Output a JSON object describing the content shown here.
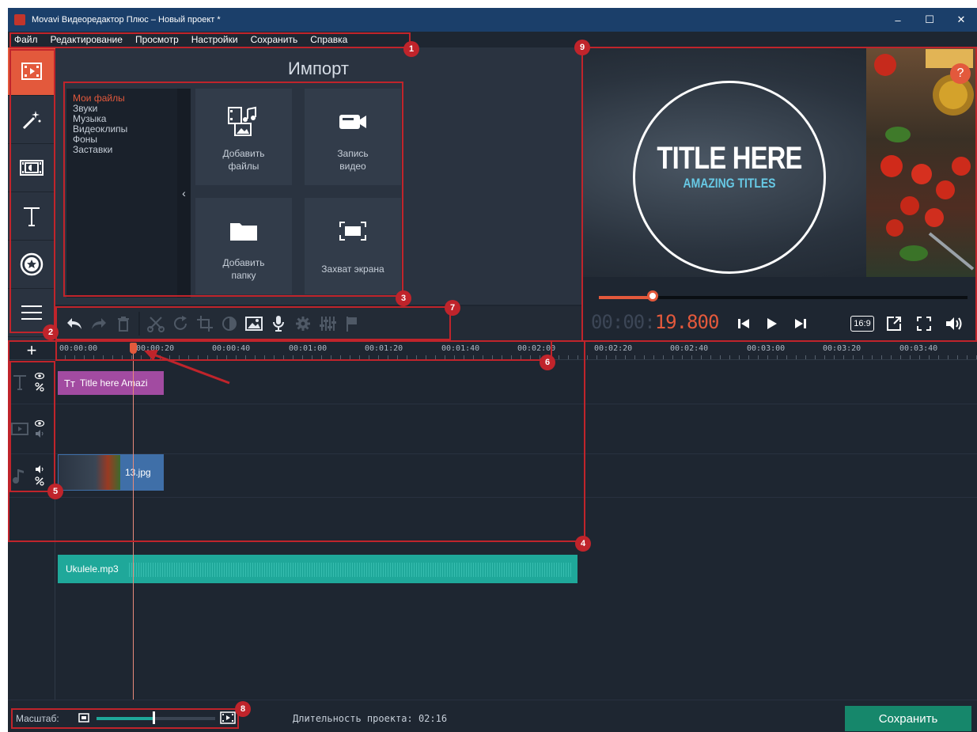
{
  "window": {
    "title": "Movavi Видеоредактор Плюс – Новый проект *",
    "controls": [
      "–",
      "☐",
      "✕"
    ]
  },
  "menu": [
    "Файл",
    "Редактирование",
    "Просмотр",
    "Настройки",
    "Сохранить",
    "Справка"
  ],
  "tools": [
    {
      "name": "import-tool",
      "icon": "film-import-icon",
      "active": true
    },
    {
      "name": "filters-tool",
      "icon": "magic-wand-icon",
      "active": false
    },
    {
      "name": "transitions-tool",
      "icon": "transition-icon",
      "active": false
    },
    {
      "name": "titles-tool",
      "icon": "text-icon",
      "active": false
    },
    {
      "name": "stickers-tool",
      "icon": "star-badge-icon",
      "active": false
    },
    {
      "name": "more-tool",
      "icon": "list-icon",
      "active": false
    }
  ],
  "import": {
    "title": "Импорт",
    "categories": [
      "Мои файлы",
      "Звуки",
      "Музыка",
      "Видеоклипы",
      "Фоны",
      "Заставки"
    ],
    "selected_category": "Мои файлы",
    "tiles": [
      {
        "label_1": "Добавить",
        "label_2": "файлы",
        "icon": "add-files-icon"
      },
      {
        "label_1": "Запись",
        "label_2": "видео",
        "icon": "camera-icon"
      },
      {
        "label_1": "Добавить",
        "label_2": "папку",
        "icon": "folder-icon"
      },
      {
        "label_1": "",
        "label_2": "Захват экрана",
        "icon": "screen-capture-icon"
      }
    ],
    "collapse_glyph": "‹"
  },
  "edit_toolbar": [
    "undo-icon",
    "redo-icon",
    "delete-icon",
    "cut-icon",
    "rotate-icon",
    "crop-icon",
    "color-adjust-icon",
    "image-icon",
    "microphone-icon",
    "settings-icon",
    "equalizer-icon",
    "flag-icon"
  ],
  "preview": {
    "title": "TITLE HERE",
    "subtitle": "AMAZING TITLES",
    "help": "?",
    "progress": 0.145,
    "timecode_dim": "00:00:",
    "timecode_hi": "19.800",
    "ratio": "16:9"
  },
  "timeline": {
    "add": "+",
    "ticks": [
      "00:00:00",
      "00:00:20",
      "00:00:40",
      "00:01:00",
      "00:01:20",
      "00:01:40",
      "00:02:00",
      "00:02:20",
      "00:02:40",
      "00:03:00",
      "00:03:20",
      "00:03:40"
    ],
    "title_clip": "Title here Amazi",
    "title_clip_prefix": "Tт",
    "image_clip": "13.jpg",
    "audio_clip": "Ukulele.mp3"
  },
  "status": {
    "scale_label": "Масштаб:",
    "zoom": 0.47,
    "duration_label": "Длительность проекта: 02:16",
    "save_label": "Сохранить"
  },
  "callouts": [
    "1",
    "2",
    "3",
    "4",
    "5",
    "6",
    "7",
    "8",
    "9"
  ],
  "colors": {
    "accent": "#e3593c",
    "callout": "#c0242b",
    "save": "#16876b",
    "title_clip": "#a24ba1",
    "image_clip": "#3f6fa8",
    "audio_clip": "#1fa89a"
  }
}
